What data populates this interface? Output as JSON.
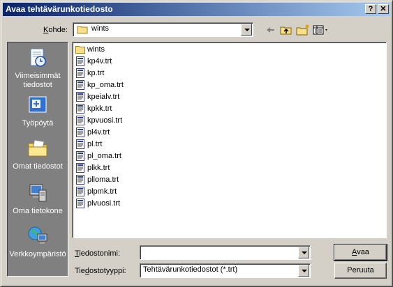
{
  "window": {
    "title": "Avaa tehtävärunkotiedosto",
    "help_label": "?",
    "close_label": "✕"
  },
  "lookin": {
    "label_prefix": "",
    "label_hotkey": "K",
    "label_rest": "ohde:",
    "value": "wints"
  },
  "places": [
    {
      "label": "Viimeisimmät tiedostot",
      "icon": "recent-documents-icon"
    },
    {
      "label": "Työpöytä",
      "icon": "desktop-icon"
    },
    {
      "label": "Omat tiedostot",
      "icon": "my-documents-icon"
    },
    {
      "label": "Oma tietokone",
      "icon": "my-computer-icon"
    },
    {
      "label": "Verkkoympäristö",
      "icon": "network-places-icon"
    }
  ],
  "files": [
    {
      "name": "wints",
      "type": "folder"
    },
    {
      "name": "kp4v.trt",
      "type": "file"
    },
    {
      "name": "kp.trt",
      "type": "file"
    },
    {
      "name": "kp_oma.trt",
      "type": "file"
    },
    {
      "name": "kpeialv.trt",
      "type": "file"
    },
    {
      "name": "kpkk.trt",
      "type": "file"
    },
    {
      "name": "kpvuosi.trt",
      "type": "file"
    },
    {
      "name": "pl4v.trt",
      "type": "file"
    },
    {
      "name": "pl.trt",
      "type": "file"
    },
    {
      "name": "pl_oma.trt",
      "type": "file"
    },
    {
      "name": "plkk.trt",
      "type": "file"
    },
    {
      "name": "plloma.trt",
      "type": "file"
    },
    {
      "name": "plpmk.trt",
      "type": "file"
    },
    {
      "name": "plvuosi.trt",
      "type": "file"
    }
  ],
  "filename": {
    "label_hotkey": "T",
    "label_rest": "iedostonimi:",
    "value": ""
  },
  "filetype": {
    "label_pre": "Tie",
    "label_hotkey": "d",
    "label_rest": "ostotyyppi:",
    "value": "Tehtävärunkotiedostot (*.trt)"
  },
  "buttons": {
    "open_hotkey": "A",
    "open_rest": "vaa",
    "cancel": "Peruuta"
  },
  "colors": {
    "title_start": "#0a246a",
    "title_end": "#a6caf0",
    "face": "#d4d0c8",
    "places_bg": "#808080"
  }
}
